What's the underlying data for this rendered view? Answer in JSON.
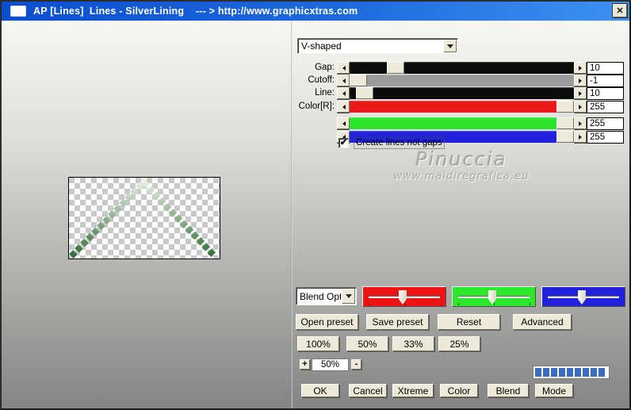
{
  "window": {
    "title": "AP [Lines]  Lines - SilverLining    --- > http://www.graphicxtras.com",
    "close_glyph": "✕"
  },
  "shape_selector": {
    "value": "V-shaped"
  },
  "param_sliders": {
    "rows": [
      {
        "label": "Gap:",
        "value": "10",
        "track_color": "#0b0b0b",
        "thumb_pos": 0.18
      },
      {
        "label": "Cutoff:",
        "value": "-1",
        "track_color": "#9b9b9b",
        "thumb_pos": 0.0
      },
      {
        "label": "Line:",
        "value": "10",
        "track_color": "#0b0b0b",
        "thumb_pos": 0.03
      },
      {
        "label": "Color[R]:",
        "value": "255",
        "track_color": "#ea1818",
        "thumb_pos": 1.0
      },
      {
        "label": "",
        "value": "255",
        "track_color": "#2be32b",
        "thumb_pos": 1.0
      },
      {
        "label": "",
        "value": "255",
        "track_color": "#2222dd",
        "thumb_pos": 1.0
      }
    ]
  },
  "options": {
    "create_lines_label": "Create lines not gaps",
    "checked": true
  },
  "watermark": {
    "name": "Pinuccia",
    "site": "www.maidiregrafica.eu"
  },
  "blend": {
    "selector_value": "Blend Opti",
    "trackbars": [
      {
        "name": "red",
        "color": "#ee1414",
        "thumb_pos": 0.48
      },
      {
        "name": "green",
        "color": "#2ce82c",
        "thumb_pos": 0.48
      },
      {
        "name": "blue",
        "color": "#2121dc",
        "thumb_pos": 0.48
      }
    ]
  },
  "preset_buttons": [
    "Open preset",
    "Save preset",
    "Reset",
    "Advanced"
  ],
  "zoom_buttons": [
    "100%",
    "50%",
    "33%",
    "25%"
  ],
  "zoom_stepper": {
    "plus": "+",
    "value": "50%",
    "minus": "-"
  },
  "progress": {
    "segments": 9,
    "color": "#3a6cc4"
  },
  "action_buttons": [
    "OK",
    "Cancel",
    "Xtreme",
    "Color",
    "Blend",
    "Mode"
  ],
  "preview": {
    "gradient_top": "#eef7e7",
    "gradient_bottom": "#2d6b35",
    "checker_color": "#c9c9c9"
  }
}
